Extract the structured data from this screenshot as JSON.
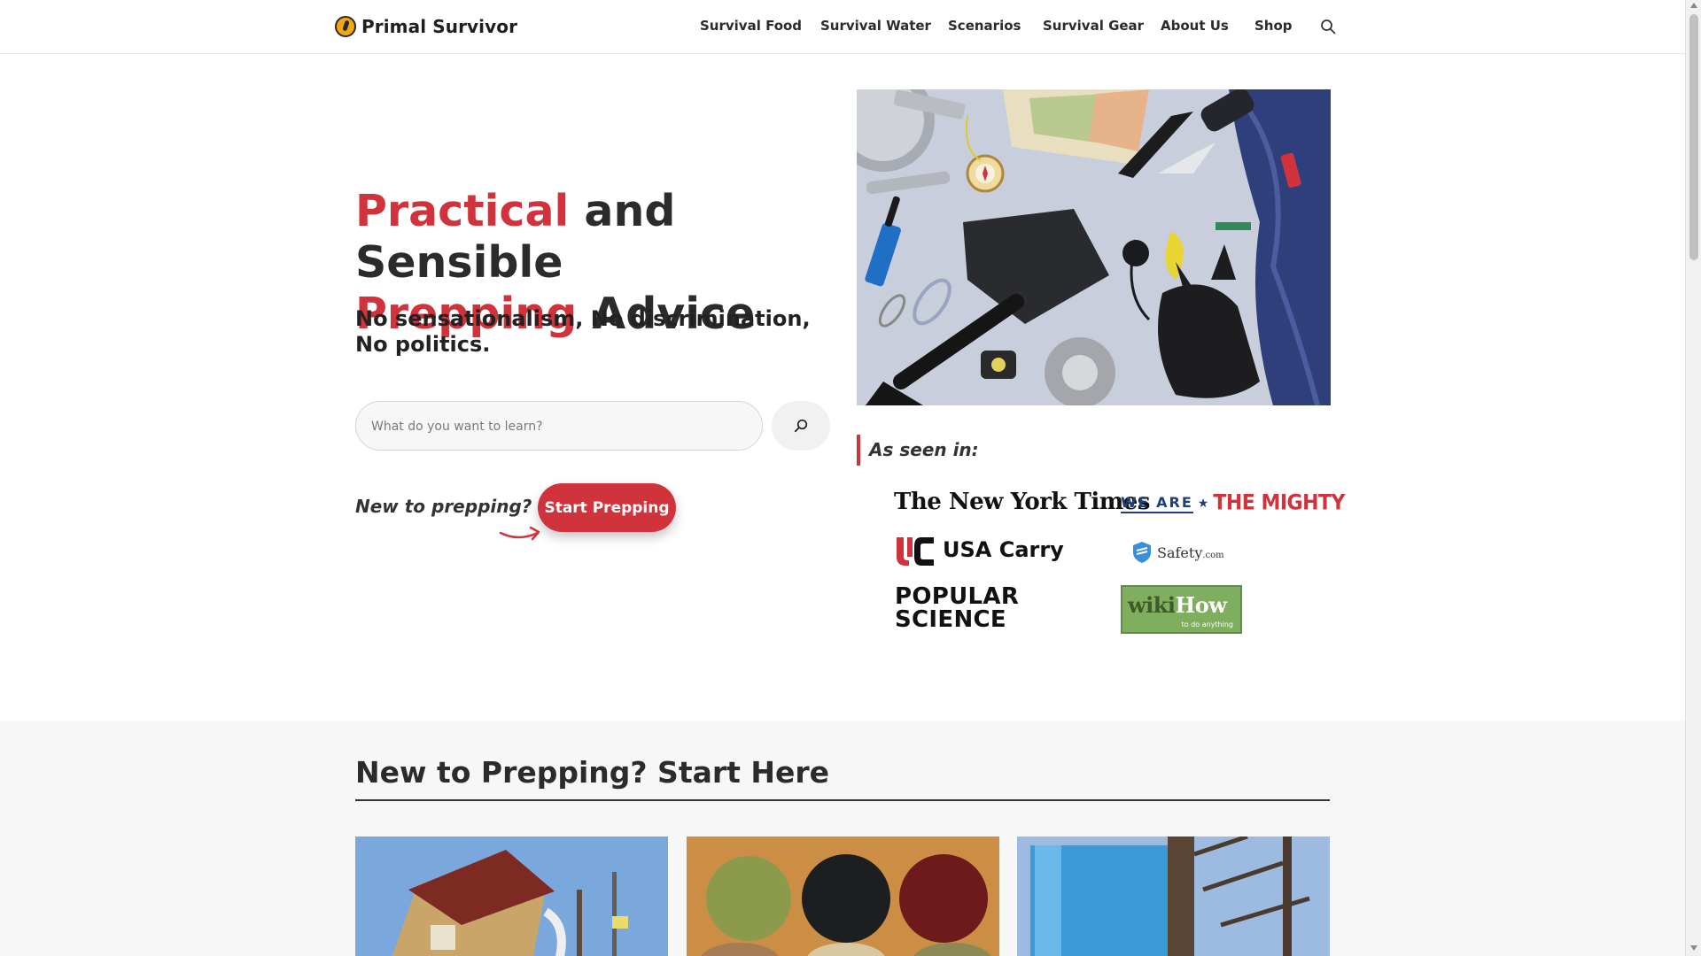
{
  "header": {
    "logo_text": "Primal Survivor",
    "nav": [
      "Survival Food",
      "Survival Water",
      "Scenarios",
      "Survival Gear",
      "About Us",
      "Shop"
    ],
    "search_icon": "search-icon"
  },
  "hero": {
    "title_accent_1": "Practical",
    "title_rest_1": " and Sensible",
    "title_accent_2": "Prepping",
    "title_rest_2": " Advice",
    "subtitle": "No sensationalism, No discrimination, No politics.",
    "search_placeholder": "What do you want to learn?",
    "new_label": "New to prepping?",
    "cta_label": "Start Prepping"
  },
  "as_seen_in": {
    "title": "As seen in:",
    "nyt": "The New York Times",
    "mighty_a": "WE ARE",
    "mighty_star": "★",
    "mighty_b": "THE MIGHTY",
    "usa_carry": "USA Carry",
    "safety": "Safety",
    "safety_suffix": ".com",
    "popsci_1": "POPULAR",
    "popsci_2": "SCIENCE",
    "wikihow_a": "wiki",
    "wikihow_b": "How",
    "wikihow_tag": "to do anything"
  },
  "start_section": {
    "title": "New to Prepping? Start Here"
  },
  "colors": {
    "accent": "#d0333b",
    "text": "#2b2b2b",
    "section_bg": "#f7f7f7"
  }
}
